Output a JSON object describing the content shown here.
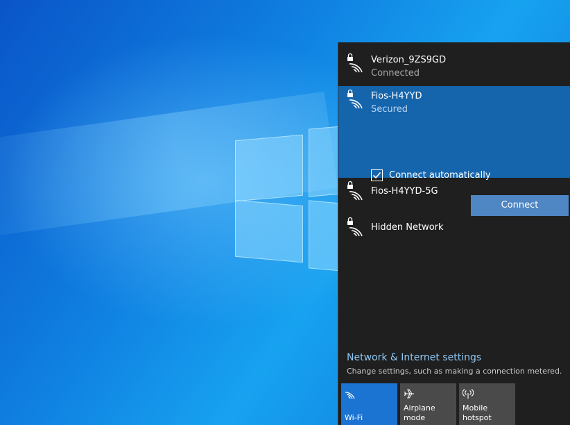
{
  "networks": [
    {
      "name": "Verizon_9ZS9GD",
      "status": "Connected"
    },
    {
      "name": "Fios-H4YYD",
      "status": "Secured"
    },
    {
      "name": "Fios-H4YYD-5G",
      "status": ""
    },
    {
      "name": "Hidden Network",
      "status": ""
    }
  ],
  "selected": {
    "connect_auto_label": "Connect automatically",
    "connect_auto_checked": true,
    "connect_button": "Connect"
  },
  "settings": {
    "link": "Network & Internet settings",
    "subtitle": "Change settings, such as making a connection metered."
  },
  "tiles": [
    {
      "label": "Wi-Fi",
      "icon": "wifi-icon",
      "active": true
    },
    {
      "label": "Airplane mode",
      "icon": "airplane-icon",
      "active": false
    },
    {
      "label_line1": "Mobile",
      "label_line2": "hotspot",
      "icon": "hotspot-icon",
      "active": false
    }
  ],
  "colors": {
    "accent": "#1565ad",
    "tile_active": "#1b74d2",
    "flyout_bg": "#1f1f1f",
    "link": "#8fc6f2"
  }
}
